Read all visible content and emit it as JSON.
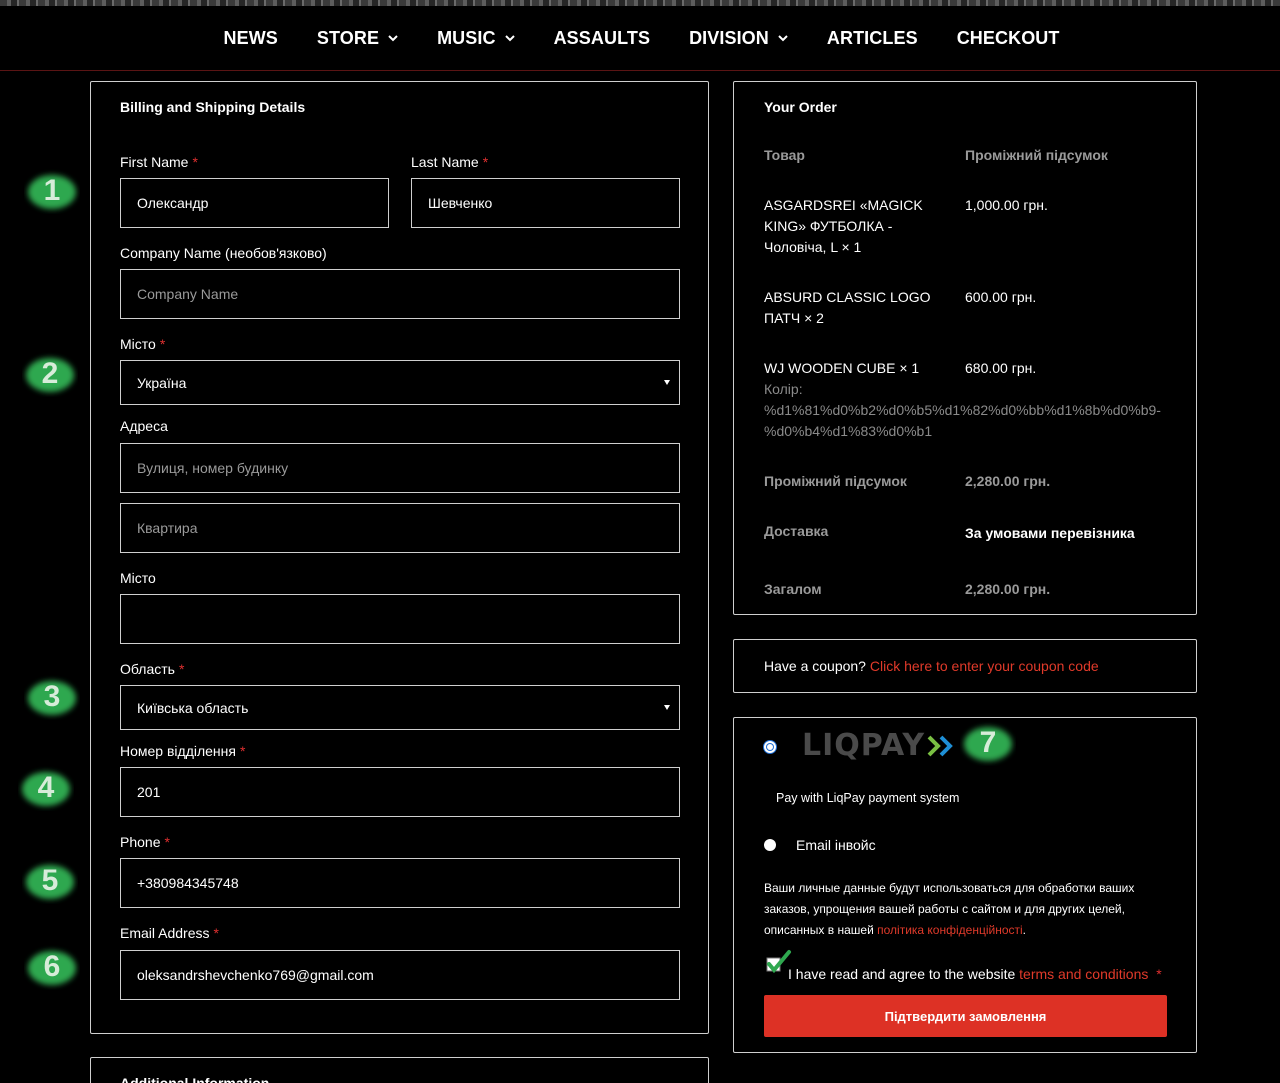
{
  "nav": {
    "items": [
      {
        "label": "NEWS",
        "dropdown": false
      },
      {
        "label": "STORE",
        "dropdown": true
      },
      {
        "label": "MUSIC",
        "dropdown": true
      },
      {
        "label": "ASSAULTS",
        "dropdown": false
      },
      {
        "label": "DIVISION",
        "dropdown": true
      },
      {
        "label": "ARTICLES",
        "dropdown": false
      },
      {
        "label": "CHECKOUT",
        "dropdown": false
      }
    ]
  },
  "billing": {
    "title": "Billing and Shipping Details",
    "first_name": {
      "label": "First Name",
      "required": "*",
      "value": "Олександр"
    },
    "last_name": {
      "label": "Last Name",
      "required": "*",
      "value": "Шевченко"
    },
    "company": {
      "label": "Company Name (необов'язково)",
      "placeholder": "Company Name"
    },
    "country": {
      "label": "Місто",
      "required": "*",
      "value": "Україна"
    },
    "address": {
      "label": "Адреса",
      "placeholder": "Вулиця, номер будинку",
      "placeholder2": "Квартира"
    },
    "city": {
      "label": "Місто",
      "value": ""
    },
    "region": {
      "label": "Область",
      "required": "*",
      "value": "Київська область"
    },
    "branch": {
      "label": "Номер відділення",
      "required": "*",
      "value": "201"
    },
    "phone": {
      "label": "Phone",
      "required": "*",
      "value": "+380984345748"
    },
    "email": {
      "label": "Email Address",
      "required": "*",
      "value": "oleksandrshevchenko769@gmail.com"
    }
  },
  "additional": {
    "title": "Additional Information"
  },
  "order": {
    "title": "Your Order",
    "col_product": "Товар",
    "col_subtotal": "Проміжний підсумок",
    "items": [
      {
        "name_lines": [
          "ASGARDSREI «MAGICK",
          "KING» ФУТБОЛКА -",
          "Чоловіча, L  × 1"
        ],
        "price": "1,000.00 грн."
      },
      {
        "name_lines": [
          "ABSURD CLASSIC LOGO",
          "ПАТЧ  × 2"
        ],
        "price": "600.00 грн."
      },
      {
        "name_lines": [
          "WJ WOODEN CUBE  × 1"
        ],
        "price": "680.00 грн.",
        "meta_lines": [
          "Колір:",
          "%d1%81%d0%b2%d0%b5%d1%82%d0%bb%d1%8b%d0%b9-",
          "%d0%b4%d1%83%d0%b1"
        ]
      }
    ],
    "subtotal_label": "Проміжний підсумок",
    "subtotal_value": "2,280.00 грн.",
    "shipping_label": "Доставка",
    "shipping_value": "За умовами перевізника",
    "total_label": "Загалом",
    "total_value": "2,280.00 грн."
  },
  "coupon": {
    "text": "Have a coupon?",
    "link": "Click here to enter your coupon code"
  },
  "payment": {
    "liqpay_logo": "LIQPAY",
    "liqpay_desc": "Pay with LiqPay payment system",
    "email_invoice": "Email інвойс",
    "privacy_lines": [
      "Ваши личные данные будут использоваться для обработки ваших",
      "заказов, упрощения вашей работы с сайтом и для других целей,"
    ],
    "privacy_line3_prefix": "описанных в нашей",
    "privacy_link": "політика конфіденційності",
    "privacy_suffix": ".",
    "terms_prefix": "I have read and agree to the website",
    "terms_link": "terms and conditions",
    "terms_required": "*",
    "confirm_button": "Підтвердити замовлення"
  },
  "annotations": [
    "1",
    "2",
    "3",
    "4",
    "5",
    "6",
    "7"
  ],
  "colors": {
    "accent_red": "#dd3125",
    "link_red": "#e03a2a",
    "radio_blue": "#1f6fd6",
    "annotation_green": "#2fa84f"
  }
}
